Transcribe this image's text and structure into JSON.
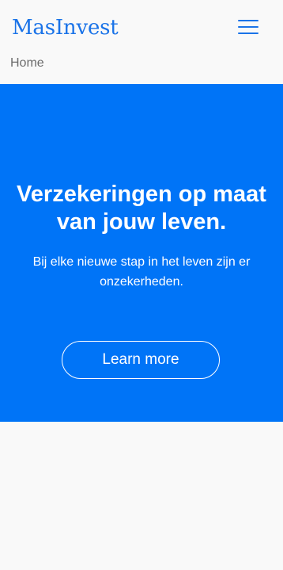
{
  "header": {
    "brand": "MasInvest",
    "menu_icon": "hamburger-menu-icon"
  },
  "breadcrumb": {
    "current": "Home"
  },
  "hero": {
    "title": "Verzekeringen op maat van jouw leven.",
    "text": "Bij elke nieuwe stap in het leven zijn er onzekerheden.",
    "button_label": "Learn more",
    "background_color": "#0074f7",
    "text_color": "#ffffff"
  },
  "colors": {
    "brand": "#1a73e8",
    "page_background": "#f9f9f9",
    "breadcrumb_text": "#6c6c6c"
  }
}
